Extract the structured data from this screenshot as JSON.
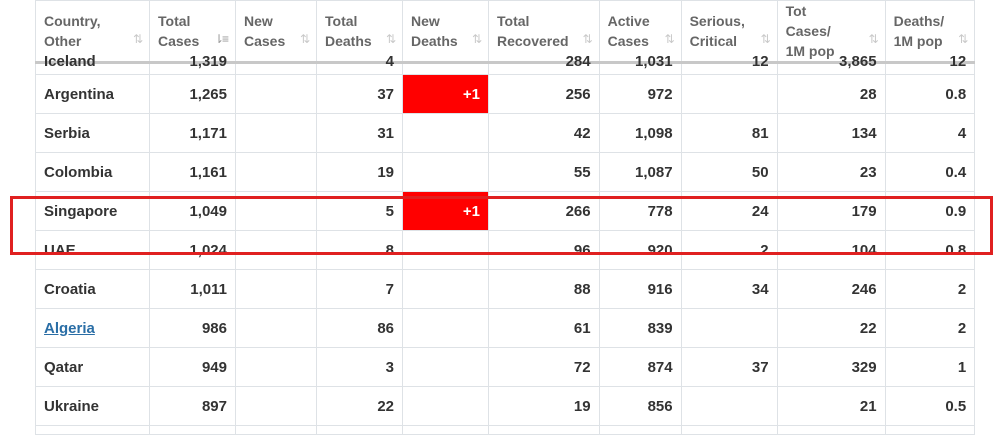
{
  "headers": [
    {
      "line1": "Country,",
      "line2": "Other",
      "sort_active": false
    },
    {
      "line1": "Total",
      "line2": "Cases",
      "sort_active": true
    },
    {
      "line1": "New",
      "line2": "Cases",
      "sort_active": false
    },
    {
      "line1": "Total",
      "line2": "Deaths",
      "sort_active": false
    },
    {
      "line1": "New",
      "line2": "Deaths",
      "sort_active": false
    },
    {
      "line1": "Total",
      "line2": "Recovered",
      "sort_active": false
    },
    {
      "line1": "Active",
      "line2": "Cases",
      "sort_active": false
    },
    {
      "line1": "Serious,",
      "line2": "Critical",
      "sort_active": false
    },
    {
      "line1": "Tot Cases/",
      "line2": "1M pop",
      "sort_active": false
    },
    {
      "line1": "Deaths/",
      "line2": "1M pop",
      "sort_active": false
    }
  ],
  "sort_icon_default": "⇅",
  "sort_icon_active": "⇂≡",
  "rows": [
    {
      "country": "Iceland",
      "link": false,
      "total_cases": "1,319",
      "new_cases": "",
      "total_deaths": "4",
      "new_deaths": "",
      "total_recovered": "284",
      "active_cases": "1,031",
      "serious": "12",
      "cases_per_1m": "3,865",
      "deaths_per_1m": "12"
    },
    {
      "country": "Argentina",
      "link": false,
      "total_cases": "1,265",
      "new_cases": "",
      "total_deaths": "37",
      "new_deaths": "+1",
      "total_recovered": "256",
      "active_cases": "972",
      "serious": "",
      "cases_per_1m": "28",
      "deaths_per_1m": "0.8"
    },
    {
      "country": "Serbia",
      "link": false,
      "total_cases": "1,171",
      "new_cases": "",
      "total_deaths": "31",
      "new_deaths": "",
      "total_recovered": "42",
      "active_cases": "1,098",
      "serious": "81",
      "cases_per_1m": "134",
      "deaths_per_1m": "4"
    },
    {
      "country": "Colombia",
      "link": false,
      "total_cases": "1,161",
      "new_cases": "",
      "total_deaths": "19",
      "new_deaths": "",
      "total_recovered": "55",
      "active_cases": "1,087",
      "serious": "50",
      "cases_per_1m": "23",
      "deaths_per_1m": "0.4"
    },
    {
      "country": "Singapore",
      "link": false,
      "total_cases": "1,049",
      "new_cases": "",
      "total_deaths": "5",
      "new_deaths": "+1",
      "total_recovered": "266",
      "active_cases": "778",
      "serious": "24",
      "cases_per_1m": "179",
      "deaths_per_1m": "0.9"
    },
    {
      "country": "UAE",
      "link": false,
      "total_cases": "1,024",
      "new_cases": "",
      "total_deaths": "8",
      "new_deaths": "",
      "total_recovered": "96",
      "active_cases": "920",
      "serious": "2",
      "cases_per_1m": "104",
      "deaths_per_1m": "0.8"
    },
    {
      "country": "Croatia",
      "link": false,
      "total_cases": "1,011",
      "new_cases": "",
      "total_deaths": "7",
      "new_deaths": "",
      "total_recovered": "88",
      "active_cases": "916",
      "serious": "34",
      "cases_per_1m": "246",
      "deaths_per_1m": "2"
    },
    {
      "country": "Algeria",
      "link": true,
      "total_cases": "986",
      "new_cases": "",
      "total_deaths": "86",
      "new_deaths": "",
      "total_recovered": "61",
      "active_cases": "839",
      "serious": "",
      "cases_per_1m": "22",
      "deaths_per_1m": "2"
    },
    {
      "country": "Qatar",
      "link": false,
      "total_cases": "949",
      "new_cases": "",
      "total_deaths": "3",
      "new_deaths": "",
      "total_recovered": "72",
      "active_cases": "874",
      "serious": "37",
      "cases_per_1m": "329",
      "deaths_per_1m": "1"
    },
    {
      "country": "Ukraine",
      "link": false,
      "total_cases": "897",
      "new_cases": "",
      "total_deaths": "22",
      "new_deaths": "",
      "total_recovered": "19",
      "active_cases": "856",
      "serious": "",
      "cases_per_1m": "21",
      "deaths_per_1m": "0.5"
    }
  ],
  "colors": {
    "new_deaths_bg": "#ff0000",
    "highlight_border": "#e02020",
    "link": "#2a6ea6"
  },
  "highlighted_country": "Singapore"
}
